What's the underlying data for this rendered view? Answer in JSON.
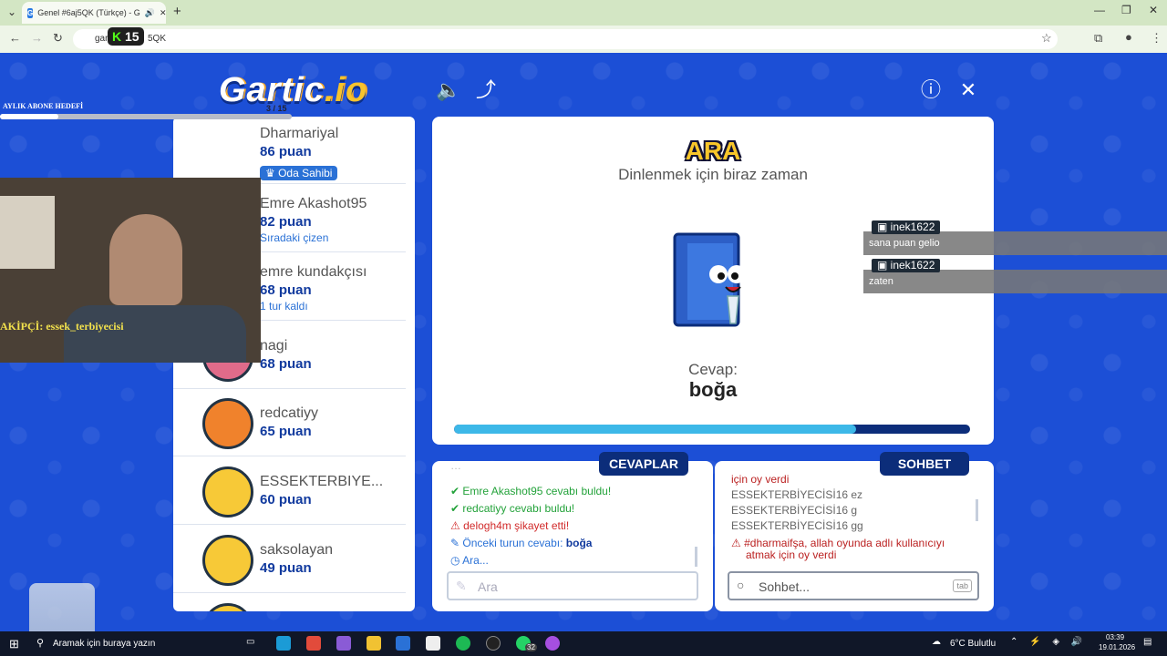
{
  "browser": {
    "tab_title": "Genel #6aj5QK (Türkçe) - G",
    "url_partial": "gar",
    "url_suffix": "5QK",
    "kick_count": "15"
  },
  "game": {
    "logo": "Gartic.io",
    "page_counter": "3 / 15",
    "players": [
      {
        "name": "Dharmariyal",
        "score": "86 puan",
        "badge": "Oda Sahibi",
        "avatar_color": "#f7b733"
      },
      {
        "name": "Emre Akashot95",
        "score": "82 puan",
        "sub": "Sıradaki çizen",
        "avatar_color": "#f7b733"
      },
      {
        "name": "emre kundakçısı",
        "score": "68 puan",
        "sub": "1 tur kaldı",
        "avatar_color": "#f7b733"
      },
      {
        "name": "nagi",
        "score": "68 puan",
        "avatar_color": "#e06b8a"
      },
      {
        "name": "redcatiyy",
        "score": "65 puan",
        "avatar_color": "#f0822c"
      },
      {
        "name": "ESSEKTERBIYE...",
        "score": "60 puan",
        "avatar_color": "#f7c937"
      },
      {
        "name": "saksolayan",
        "score": "49 puan",
        "avatar_color": "#f7c937"
      }
    ],
    "stage": {
      "title": "ARA",
      "subtitle": "Dinlenmek için biraz zaman",
      "answer_label": "Cevap:",
      "answer": "boğa",
      "progress_fraction": 0.78
    },
    "answers_tab": "CEVAPLAR",
    "chat_tab": "SOHBET",
    "answers": [
      {
        "user": "Emre Akashot95",
        "text": " cevabı buldu!",
        "color": "#23a23a"
      },
      {
        "user": "redcatiyy",
        "text": " cevabı buldu!",
        "color": "#23a23a"
      },
      {
        "user": "delogh4m",
        "text": " şikayet etti!",
        "color": "#d12a2a"
      },
      {
        "user": "Önceki turun cevabı: ",
        "text": "boğa",
        "color": "#2a71d6"
      },
      {
        "user": "Ara...",
        "text": "",
        "color": "#2a71d6"
      }
    ],
    "answer_placeholder": "Ara",
    "chat_messages": [
      {
        "text": "için oy verdi",
        "color": "#b22"
      },
      {
        "text": "ESSEKTERBİYECİSİ16 ez",
        "color": "#666"
      },
      {
        "text": "ESSEKTERBİYECİSİ16 g",
        "color": "#666"
      },
      {
        "text": "ESSEKTERBİYECİSİ16 gg",
        "color": "#666"
      },
      {
        "text": "#dharmaifşa, allah oyunda adlı kullanıcıyı",
        "color": "#b22"
      },
      {
        "text": "atmak için oy verdi",
        "color": "#b22"
      }
    ],
    "chat_placeholder": "Sohbet...",
    "chat_tab_key": "tab",
    "float_msgs": [
      {
        "user": "inek1622",
        "text": "sana puan gelio"
      },
      {
        "user": "inek1622",
        "text": "zaten"
      }
    ]
  },
  "stream": {
    "goal_label": "AYLIK ABONE HEDEFİ",
    "follower": "AKİPÇİ: essek_terbiyecisi"
  },
  "taskbar": {
    "search": "Aramak için buraya yazın",
    "weather": "6°C  Bulutlu",
    "time": "03:39",
    "date": "19.01.2026",
    "badge": "32"
  }
}
